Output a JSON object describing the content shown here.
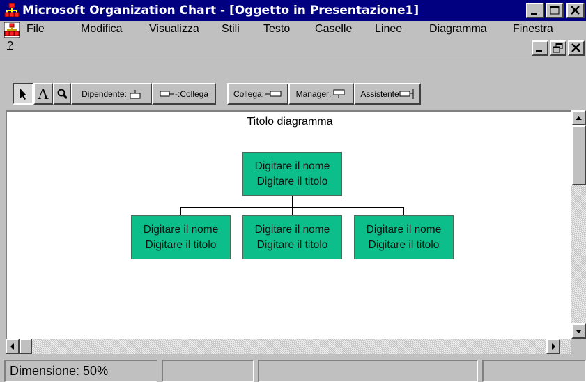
{
  "window": {
    "title": "Microsoft Organization Chart - [Oggetto in Presentazione1]",
    "caption_buttons": [
      "minimize",
      "maximize",
      "close"
    ]
  },
  "menu": {
    "items": [
      {
        "label": "File",
        "accel": "F",
        "rest": "ile"
      },
      {
        "label": "Modifica",
        "accel": "M",
        "rest": "odifica"
      },
      {
        "label": "Visualizza",
        "accel": "V",
        "rest": "isualizza"
      },
      {
        "label": "Stili",
        "accel": "S",
        "rest": "tili"
      },
      {
        "label": "Testo",
        "accel": "T",
        "rest": "esto"
      },
      {
        "label": "Caselle",
        "accel": "C",
        "rest": "aselle"
      },
      {
        "label": "Linee",
        "accel": "L",
        "rest": "inee"
      },
      {
        "label": "Diagramma",
        "accel": "D",
        "rest": "iagramma"
      },
      {
        "label": "Finestra",
        "pre": "Fi",
        "accel": "n",
        "rest": "estra"
      }
    ],
    "help": "?"
  },
  "toolbar": {
    "text_tool": "A",
    "dipendente": "Dipendente:",
    "collega_left": "-:Collega",
    "collega_right": "Collega:",
    "manager": "Manager:",
    "assistente": "Assistente"
  },
  "chart": {
    "title": "Titolo diagramma",
    "boxes": [
      {
        "name": "Digitare il nome",
        "role": "Digitare il titolo"
      },
      {
        "name": "Digitare il nome",
        "role": "Digitare il titolo"
      },
      {
        "name": "Digitare il nome",
        "role": "Digitare il titolo"
      },
      {
        "name": "Digitare il nome",
        "role": "Digitare il titolo"
      }
    ],
    "box_color": "#0cbf8a"
  },
  "status": {
    "zoom": "Dimensione: 50%"
  },
  "colors": {
    "titlebar": "#000080",
    "chrome": "#c0c0c0"
  }
}
